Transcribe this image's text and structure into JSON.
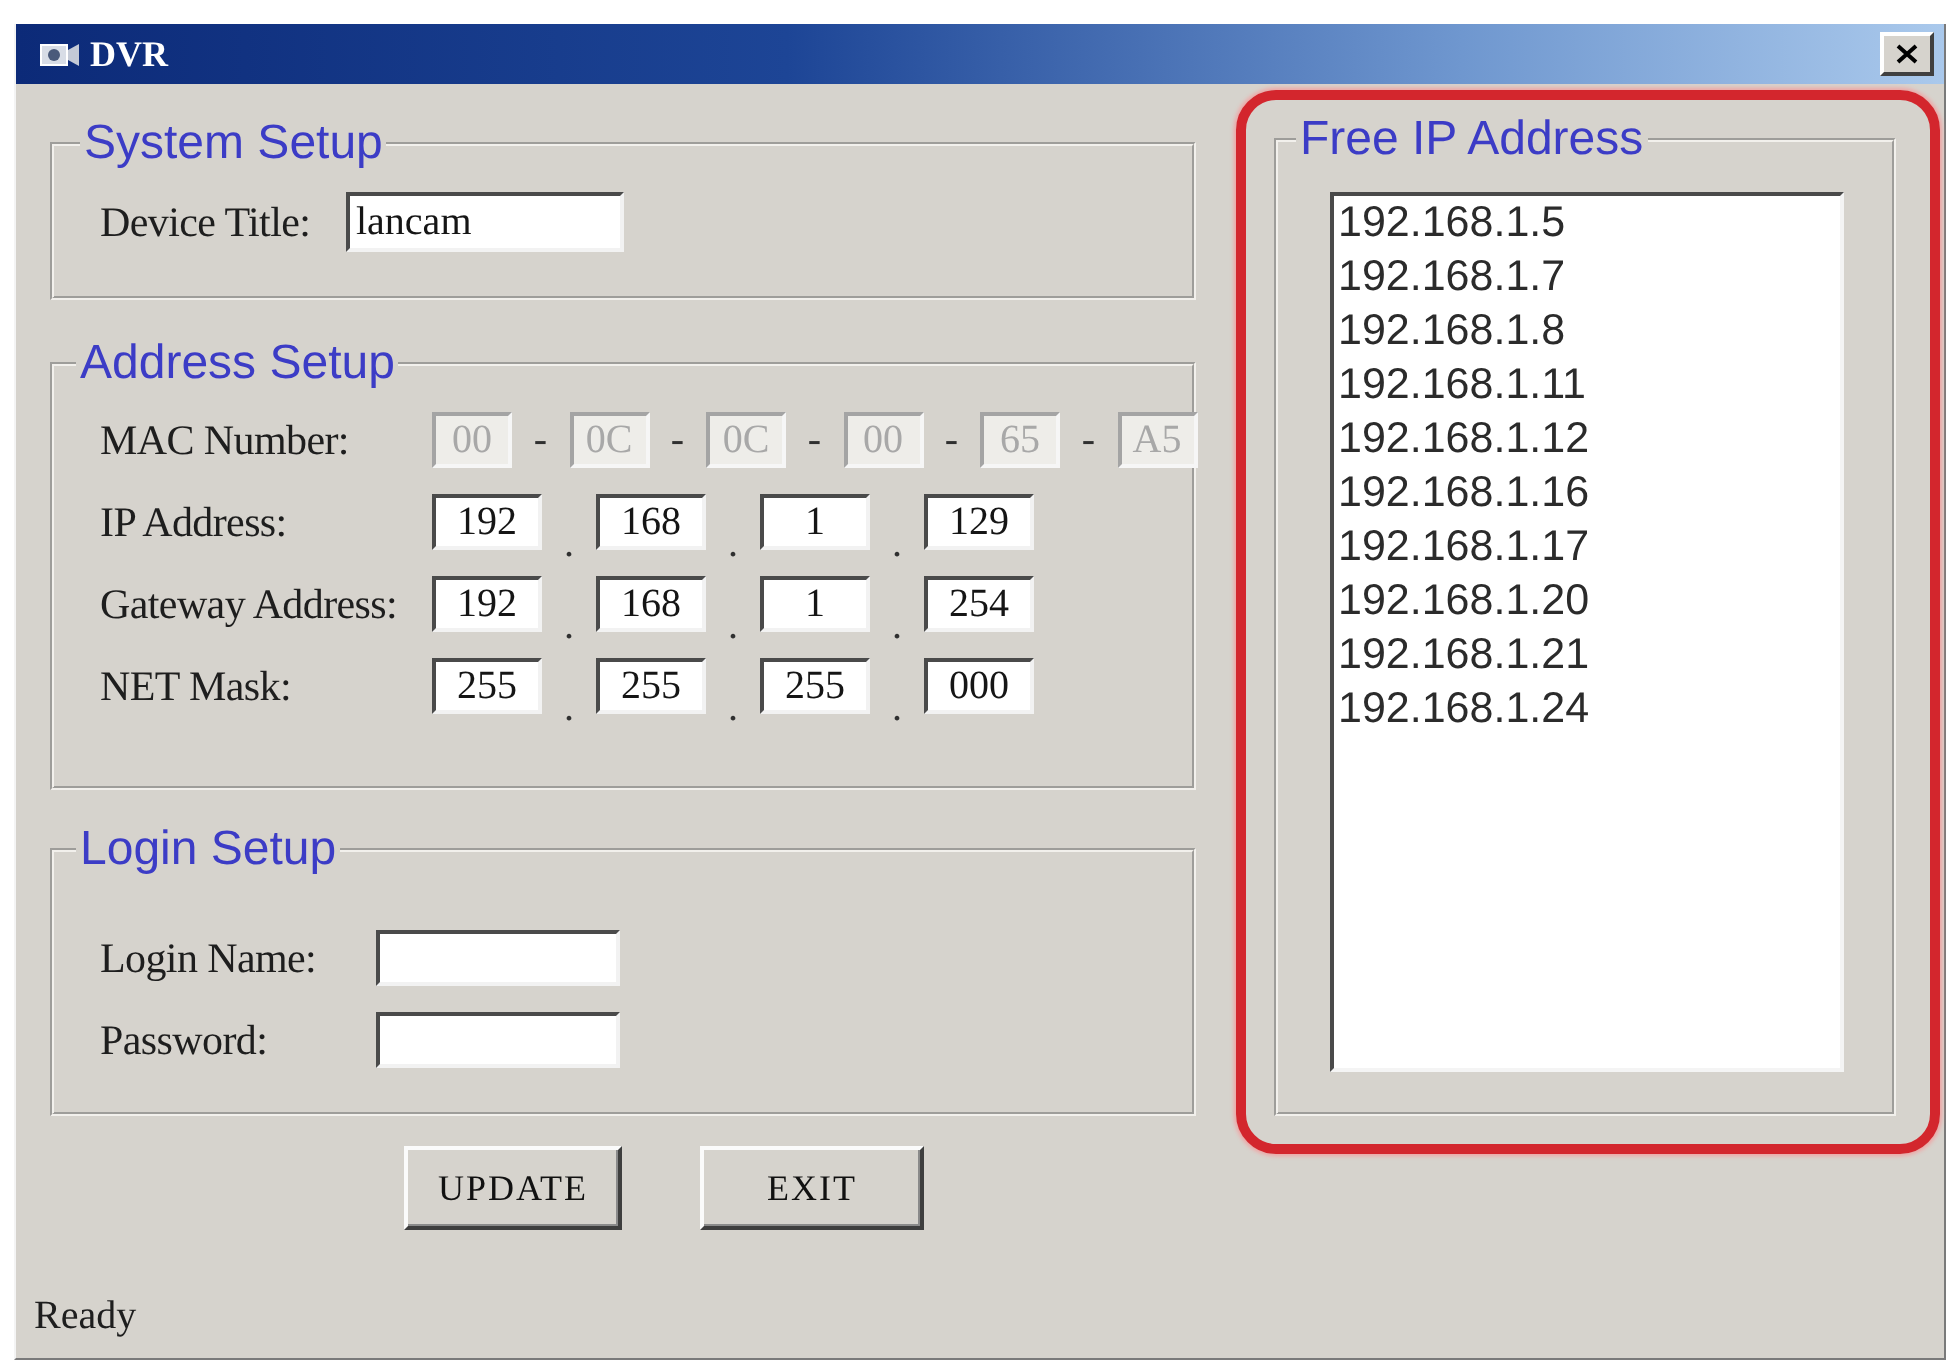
{
  "window": {
    "title": "DVR"
  },
  "system_setup": {
    "legend": "System Setup",
    "device_title": {
      "label": "Device Title:",
      "value": "lancam"
    }
  },
  "address_setup": {
    "legend": "Address Setup",
    "rows": [
      {
        "label": "MAC Number:",
        "kind": "mac",
        "fields": [
          {
            "value": "00",
            "disabled": true
          },
          {
            "separator": "-",
            "value": "0C",
            "disabled": true
          },
          {
            "separator": "-",
            "value": "0C",
            "disabled": true
          },
          {
            "separator": "-",
            "value": "00",
            "disabled": true
          },
          {
            "separator": "-",
            "value": "65",
            "disabled": true
          },
          {
            "separator": "-",
            "value": "A5",
            "disabled": true
          }
        ]
      },
      {
        "label": "IP Address:",
        "kind": "ip",
        "fields": [
          {
            "value": "192",
            "disabled": false
          },
          {
            "separator": ".",
            "value": "168",
            "disabled": false
          },
          {
            "separator": ".",
            "value": "1",
            "disabled": false
          },
          {
            "separator": ".",
            "value": "129",
            "disabled": false
          }
        ]
      },
      {
        "label": "Gateway Address:",
        "kind": "ip",
        "fields": [
          {
            "value": "192",
            "disabled": false
          },
          {
            "separator": ".",
            "value": "168",
            "disabled": false
          },
          {
            "separator": ".",
            "value": "1",
            "disabled": false
          },
          {
            "separator": ".",
            "value": "254",
            "disabled": false
          }
        ]
      },
      {
        "label": "NET Mask:",
        "kind": "ip",
        "fields": [
          {
            "value": "255",
            "disabled": false
          },
          {
            "separator": ".",
            "value": "255",
            "disabled": false
          },
          {
            "separator": ".",
            "value": "255",
            "disabled": false
          },
          {
            "separator": ".",
            "value": "000",
            "disabled": false
          }
        ]
      }
    ]
  },
  "login_setup": {
    "legend": "Login Setup",
    "fields": [
      {
        "label": "Login Name:"
      },
      {
        "label": "Password:"
      }
    ]
  },
  "buttons": [
    "UPDATE",
    "EXIT"
  ],
  "free_ip_address": {
    "legend": "Free IP Address",
    "highlighted": true,
    "items": [
      {
        "text": "192.168.1.5",
        "selected": false
      },
      {
        "text": "192.168.1.7",
        "selected": false
      },
      {
        "text": "192.168.1.8",
        "selected": false
      },
      {
        "text": "192.168.1.11",
        "selected": false
      },
      {
        "text": "192.168.1.12",
        "selected": false
      },
      {
        "text": "192.168.1.16",
        "selected": false
      },
      {
        "text": "192.168.1.17",
        "selected": false
      },
      {
        "text": "192.168.1.20",
        "selected": false
      },
      {
        "text": "192.168.1.21",
        "selected": false
      },
      {
        "text": "192.168.1.24",
        "selected": false
      }
    ]
  },
  "status_bar": "Ready"
}
